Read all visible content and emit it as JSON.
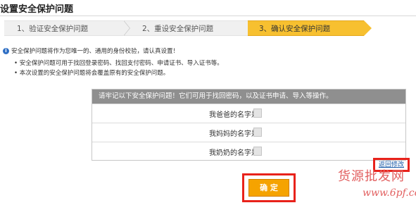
{
  "page": {
    "title": "设置安全保护问题"
  },
  "steps": [
    {
      "label": "1、验证安全保护问题"
    },
    {
      "label": "2、重设安全保护问题"
    },
    {
      "label": "3、确认安全保护问题"
    }
  ],
  "info": {
    "main": "安全保护问题将作为您唯一的、通用的身份校验，请认真设置！",
    "bullets": [
      "• 安全保护问题可用于找回登录密码、找回支付密码、申请证书、导入证书等。",
      "• 本次设置的安全保护问题将会覆盖原有的安全保护问题。"
    ]
  },
  "table": {
    "header": "请牢记以下安全保护问题！它们可用于找回密码，以及证书申请、导入等操作。",
    "questions": [
      {
        "label": "我爸爸的名字是："
      },
      {
        "label": "我妈妈的名字是："
      },
      {
        "label": "我奶奶的名字是："
      }
    ]
  },
  "actions": {
    "back_link": "返回修改",
    "confirm": "确 定"
  },
  "watermark": {
    "text": "货源批发网",
    "url": "www.6pf.com"
  },
  "colors": {
    "active_step": "#f7c030",
    "table_header": "#8f8f8f",
    "confirm_button": "#f5a300",
    "highlight_border": "#e8221b",
    "link": "#1a5ba8"
  }
}
